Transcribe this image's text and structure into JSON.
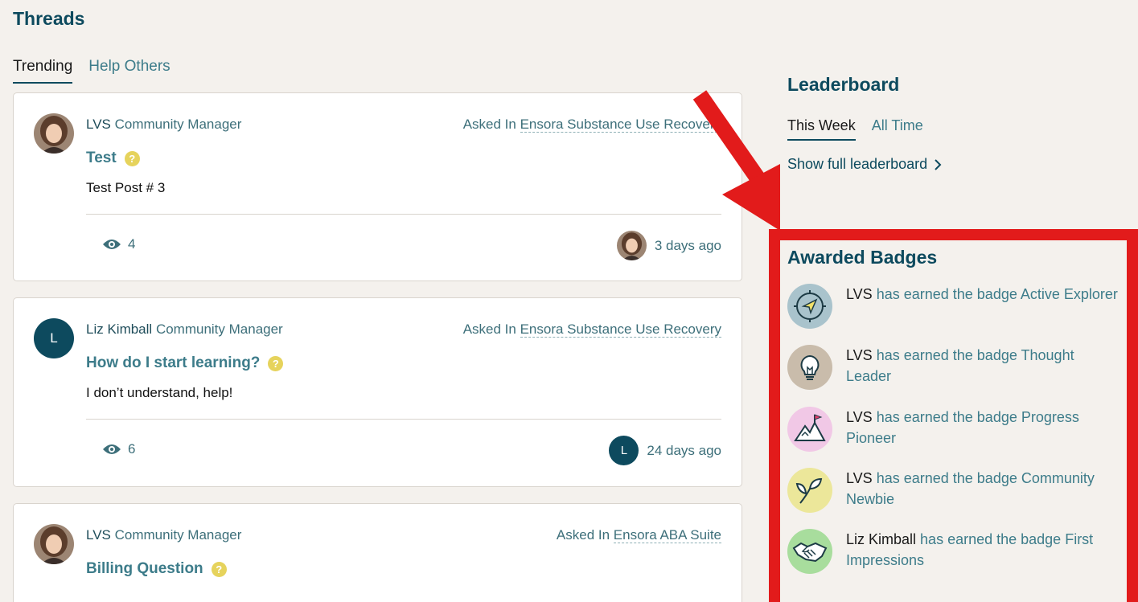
{
  "header": {
    "title": "Threads"
  },
  "tabs": [
    {
      "label": "Trending",
      "active": true
    },
    {
      "label": "Help Others",
      "active": false
    }
  ],
  "threads": [
    {
      "author": "LVS",
      "role": "Community Manager",
      "asked_prefix": "Asked In",
      "group": "Ensora Substance Use Recovery",
      "title": "Test",
      "body": "Test Post # 3",
      "views": "4",
      "time": "3 days ago"
    },
    {
      "author": "Liz Kimball",
      "role": "Community Manager",
      "avatar_letter": "L",
      "asked_prefix": "Asked In",
      "group": "Ensora Substance Use Recovery",
      "title": "How do I start learning?",
      "body": "I don’t understand, help!",
      "views": "6",
      "time": "24 days ago"
    },
    {
      "author": "LVS",
      "role": "Community Manager",
      "asked_prefix": "Asked In",
      "group": "Ensora ABA Suite",
      "title": "Billing Question"
    }
  ],
  "leaderboard": {
    "title": "Leaderboard",
    "tabs": [
      {
        "label": "This Week",
        "active": true
      },
      {
        "label": "All Time",
        "active": false
      }
    ],
    "link": "Show full leaderboard"
  },
  "badges": {
    "title": "Awarded Badges",
    "items": [
      {
        "who": "LVS",
        "text": "has earned the badge Active Explorer",
        "icon": "compass-icon",
        "color": "#a9c3cc"
      },
      {
        "who": "LVS",
        "text": "has earned the badge Thought Leader",
        "icon": "lightbulb-icon",
        "color": "#c9bcab"
      },
      {
        "who": "LVS",
        "text": "has earned the badge Progress Pioneer",
        "icon": "mountain-flag-icon",
        "color": "#f1c8e6"
      },
      {
        "who": "LVS",
        "text": "has earned the badge Community Newbie",
        "icon": "sprout-icon",
        "color": "#ece79a"
      },
      {
        "who": "Liz Kimball",
        "text": "has earned the badge First Impressions",
        "icon": "handshake-icon",
        "color": "#a8dd9d"
      }
    ]
  },
  "colors": {
    "accent": "#0d4a5e",
    "highlight_border": "#e21b1b",
    "link": "#3d7c8a"
  }
}
